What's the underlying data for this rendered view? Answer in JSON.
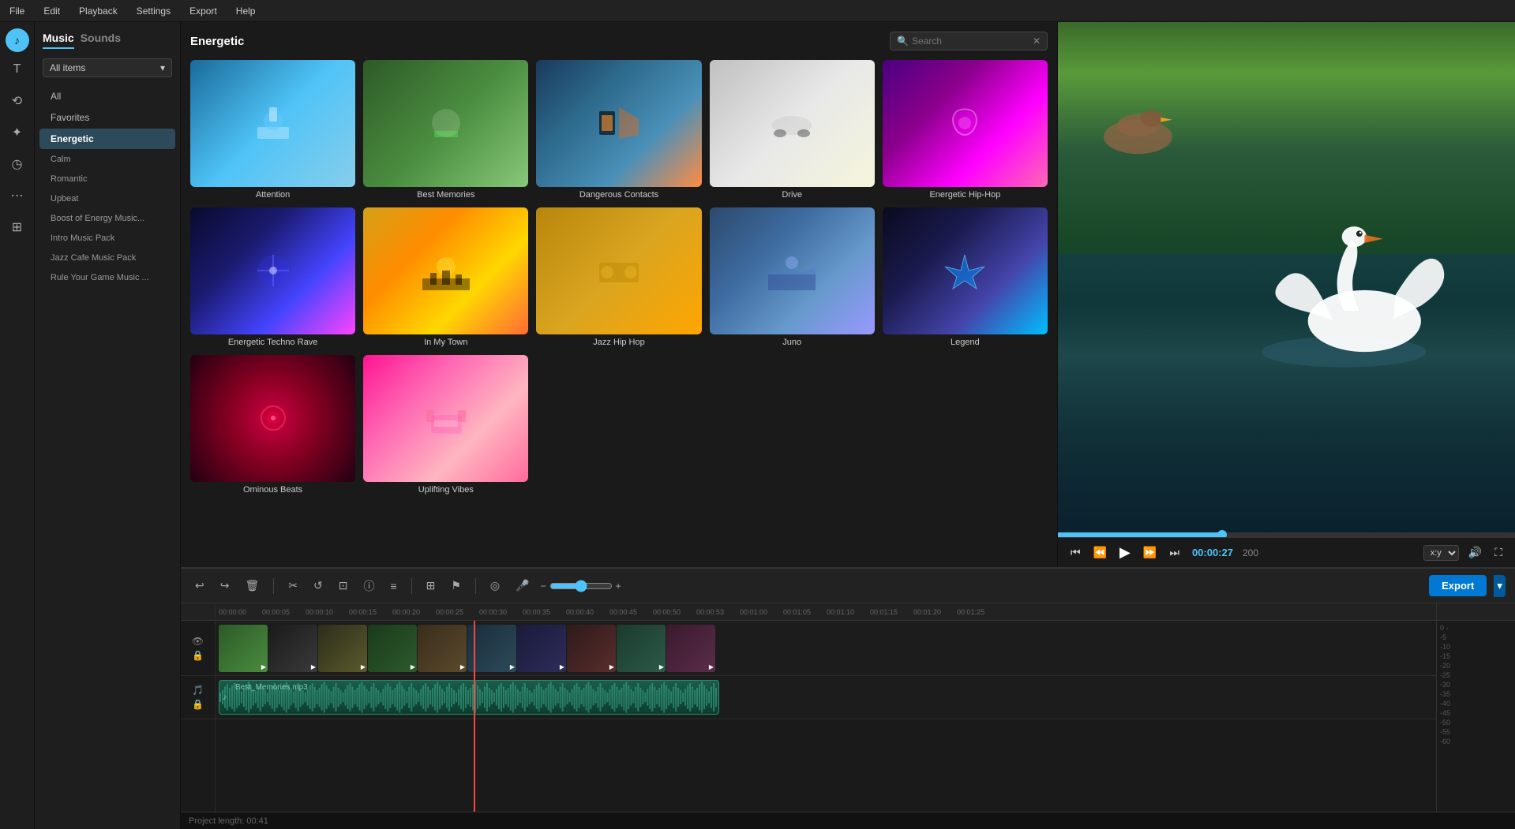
{
  "menubar": {
    "items": [
      "File",
      "Edit",
      "Playback",
      "Settings",
      "Export",
      "Help"
    ]
  },
  "tabs": {
    "music": "Music",
    "sounds": "Sounds"
  },
  "panel": {
    "filter_label": "All items",
    "nav": [
      {
        "id": "all",
        "label": "All"
      },
      {
        "id": "favorites",
        "label": "Favorites"
      },
      {
        "id": "energetic",
        "label": "Energetic",
        "active": true
      },
      {
        "id": "calm",
        "label": "Calm"
      },
      {
        "id": "romantic",
        "label": "Romantic"
      },
      {
        "id": "upbeat",
        "label": "Upbeat"
      },
      {
        "id": "boost",
        "label": "Boost of Energy Music..."
      },
      {
        "id": "intro",
        "label": "Intro Music Pack"
      },
      {
        "id": "jazz",
        "label": "Jazz Cafe Music Pack"
      },
      {
        "id": "rule",
        "label": "Rule Your Game Music ..."
      }
    ]
  },
  "grid": {
    "title": "Energetic",
    "search_placeholder": "Search",
    "items": [
      {
        "id": "attention",
        "label": "Attention",
        "thumb_class": "thumb-attention"
      },
      {
        "id": "best",
        "label": "Best Memories",
        "thumb_class": "thumb-best"
      },
      {
        "id": "dangerous",
        "label": "Dangerous Contacts",
        "thumb_class": "thumb-dangerous"
      },
      {
        "id": "drive",
        "label": "Drive",
        "thumb_class": "thumb-drive"
      },
      {
        "id": "hip-hop",
        "label": "Energetic Hip-Hop",
        "thumb_class": "thumb-hip-hop"
      },
      {
        "id": "techno",
        "label": "Energetic Techno Rave",
        "thumb_class": "thumb-techno"
      },
      {
        "id": "town",
        "label": "In My Town",
        "thumb_class": "thumb-town"
      },
      {
        "id": "jazz-hip",
        "label": "Jazz Hip Hop",
        "thumb_class": "thumb-jazz-hip"
      },
      {
        "id": "juno",
        "label": "Juno",
        "thumb_class": "thumb-juno"
      },
      {
        "id": "legend",
        "label": "Legend",
        "thumb_class": "thumb-legend"
      },
      {
        "id": "ominous",
        "label": "Ominous Beats",
        "thumb_class": "thumb-ominous"
      },
      {
        "id": "uplifting",
        "label": "Uplifting Vibes",
        "thumb_class": "thumb-uplifting"
      }
    ]
  },
  "preview": {
    "time": "00:00:27",
    "fps": "200",
    "ratio": "x:y"
  },
  "timeline": {
    "ruler_marks": [
      "00:00:00",
      "00:00:05",
      "00:00:10",
      "00:00:15",
      "00:00:20",
      "00:00:25",
      "00:00:30",
      "00:00:35",
      "00:00:40",
      "00:00:45",
      "00:00:50",
      "00:00:53",
      "00:01:00",
      "00:01:05",
      "00:01:10",
      "00:01:15",
      "00:01:20",
      "00:01:25"
    ],
    "audio_label": "Best_Memories.mp3",
    "scale_marks": [
      "0-",
      "-5",
      "-10",
      "-15",
      "-20",
      "-25",
      "-30",
      "-35",
      "-40",
      "-45",
      "-50",
      "-55",
      "-60"
    ]
  },
  "toolbar": {
    "export_label": "Export"
  },
  "status": {
    "text": "Project length: 00:41"
  }
}
